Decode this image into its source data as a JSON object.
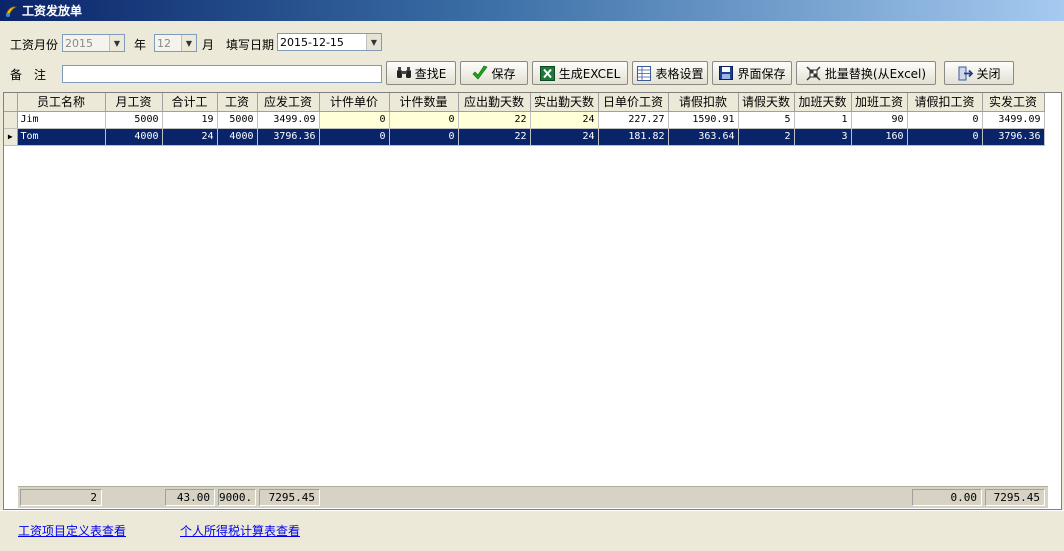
{
  "window": {
    "title": "工资发放单"
  },
  "form": {
    "month_label": "工资月份",
    "year_value": "2015",
    "year_suffix": "年",
    "month_value": "12",
    "month_suffix": "月",
    "fill_date_label": "填写日期",
    "fill_date_value": "2015-12-15",
    "remark_label": "备　注",
    "remark_value": ""
  },
  "toolbar": {
    "find": "查找E",
    "save": "保存",
    "excel": "生成EXCEL",
    "table_settings": "表格设置",
    "interface_save": "界面保存",
    "batch_replace": "批量替换(从Excel)",
    "close": "关闭"
  },
  "grid": {
    "columns": [
      "员工名称",
      "月工资",
      "合计工",
      "工资",
      "应发工资",
      "计件单价",
      "计件数量",
      "应出勤天数",
      "实出勤天数",
      "日单价工资",
      "请假扣款",
      "请假天数",
      "加班天数",
      "加班工资",
      "请假扣工资",
      "实发工资"
    ],
    "rows": [
      [
        "Jim",
        "5000",
        "19",
        "5000",
        "3499.09",
        "0",
        "0",
        "22",
        "24",
        "227.27",
        "1590.91",
        "5",
        "1",
        "90",
        "0",
        "3499.09"
      ],
      [
        "Tom",
        "4000",
        "24",
        "4000",
        "3796.36",
        "0",
        "0",
        "22",
        "24",
        "181.82",
        "363.64",
        "2",
        "3",
        "160",
        "0",
        "3796.36"
      ]
    ],
    "selected_row": 1
  },
  "totals": {
    "count": "2",
    "total_work": "43.00",
    "wage": "9000.",
    "payable": "7295.45",
    "leave_deduct": "0.00",
    "actual": "7295.45"
  },
  "links": {
    "wage_items": "工资项目定义表查看",
    "income_tax": "个人所得税计算表查看"
  },
  "colors": {
    "selection": "#0a246a",
    "highlight_cell": "#ffffd8",
    "link": "#0000ee"
  }
}
